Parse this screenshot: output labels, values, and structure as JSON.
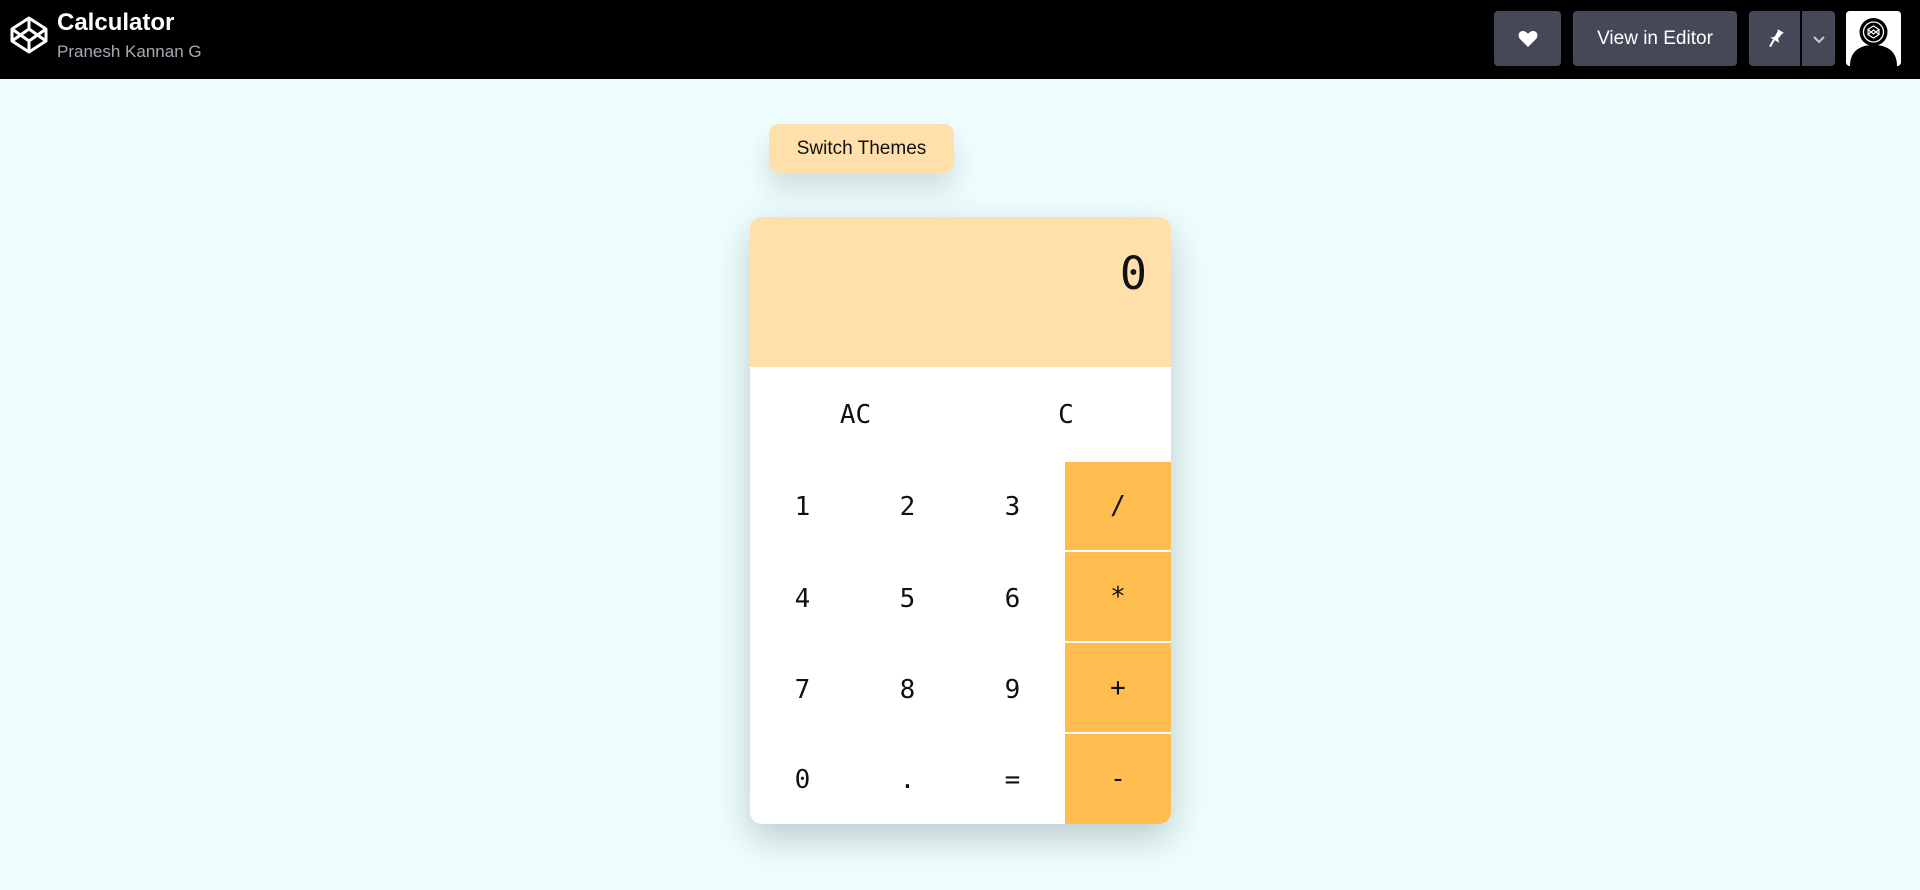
{
  "header": {
    "title": "Calculator",
    "author": "Pranesh Kannan G",
    "view_in_editor_label": "View in Editor",
    "heart_icon": "heart-icon",
    "pin_icon": "pin-icon",
    "chevron_icon": "chevron-down-icon"
  },
  "main": {
    "switch_themes_label": "Switch Themes"
  },
  "calculator": {
    "display_value": "0",
    "keys": {
      "ac": "AC",
      "c": "C",
      "k1": "1",
      "k2": "2",
      "k3": "3",
      "div": "/",
      "k4": "4",
      "k5": "5",
      "k6": "6",
      "mul": "*",
      "k7": "7",
      "k8": "8",
      "k9": "9",
      "add": "+",
      "k0": "0",
      "dot": ".",
      "eq": "=",
      "sub": "-"
    }
  },
  "colors": {
    "page_background": "#effefe",
    "display_background": "#ffe0aa",
    "operator_background": "#ffbc4f",
    "topbar_background": "#000000",
    "topbar_button": "#444857"
  }
}
